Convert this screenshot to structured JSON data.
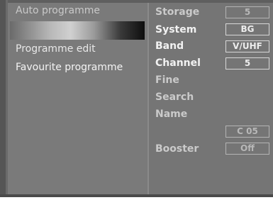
{
  "menu": {
    "items": [
      {
        "label": "Auto programme"
      },
      {
        "label": "Programme edit"
      },
      {
        "label": "Favourite programme"
      }
    ]
  },
  "settings": {
    "storage": {
      "label": "Storage",
      "value": "5"
    },
    "system": {
      "label": "System",
      "value": "BG"
    },
    "band": {
      "label": "Band",
      "value": "V/UHF"
    },
    "channel": {
      "label": "Channel",
      "value": "5"
    },
    "fine": {
      "label": "Fine"
    },
    "search": {
      "label": "Search"
    },
    "name": {
      "label": "Name"
    },
    "extra": {
      "value": "C 05"
    },
    "booster": {
      "label": "Booster",
      "value": "Off"
    }
  }
}
